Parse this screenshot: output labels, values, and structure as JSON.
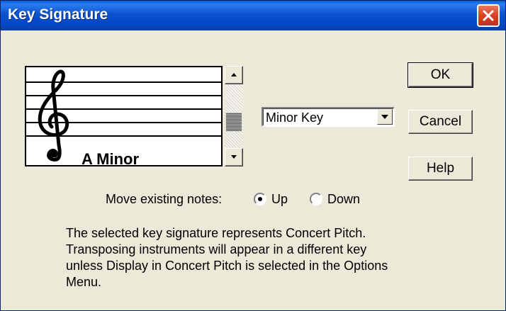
{
  "window": {
    "title": "Key Signature"
  },
  "staff": {
    "key_label": "A Minor",
    "clef": "treble-clef-icon"
  },
  "key_type": {
    "selected": "Minor Key"
  },
  "buttons": {
    "ok": "OK",
    "cancel": "Cancel",
    "help": "Help"
  },
  "move_notes": {
    "label": "Move existing notes:",
    "options": [
      {
        "label": "Up",
        "selected": true
      },
      {
        "label": "Down",
        "selected": false
      }
    ]
  },
  "info_lines": [
    "The selected key signature represents Concert Pitch.",
    "Transposing instruments will appear in a different key",
    "unless Display in Concert Pitch is selected in the Options",
    "Menu."
  ],
  "colors": {
    "titlebar": "#0b53cf",
    "dialog_bg": "#ece9d8",
    "close_button": "#d9402a"
  }
}
